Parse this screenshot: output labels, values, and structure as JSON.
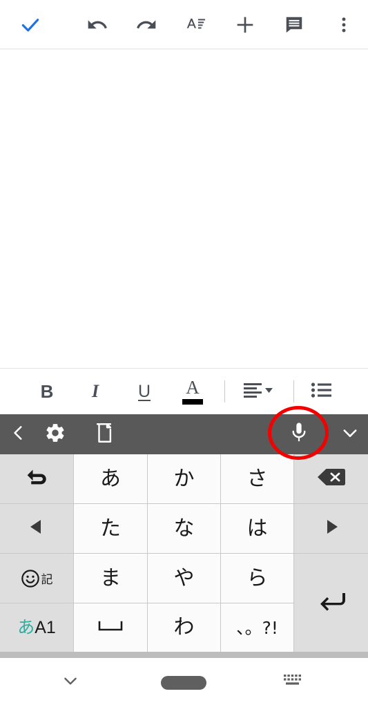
{
  "app": {
    "name": "Document editor",
    "accent_blue": "#1a73e8",
    "toolbar_icon_color": "#4a4f57",
    "ime_bar_color": "#595959",
    "key_kana_bg": "#fbfbfb",
    "key_func_bg": "#dedede",
    "mode_kana_color": "#2bb0a3",
    "annotation_color": "#f40000"
  },
  "top_toolbar": {
    "buttons": [
      {
        "name": "accept-check-button",
        "icon": "check-icon",
        "label": "Done",
        "color": "#1a73e8"
      },
      {
        "name": "undo-button",
        "icon": "undo-icon",
        "label": "Undo"
      },
      {
        "name": "redo-button",
        "icon": "redo-icon",
        "label": "Redo"
      },
      {
        "name": "format-button",
        "icon": "format-text-icon",
        "label": "Format"
      },
      {
        "name": "insert-button",
        "icon": "plus-icon",
        "label": "Insert"
      },
      {
        "name": "comment-button",
        "icon": "comment-icon",
        "label": "Comment"
      },
      {
        "name": "more-options-button",
        "icon": "overflow-menu-icon",
        "label": "More options"
      }
    ]
  },
  "document": {
    "body_text": "",
    "background": "#ffffff"
  },
  "format_bar": {
    "buttons": [
      {
        "name": "bold-button",
        "label": "B",
        "icon": "bold-icon"
      },
      {
        "name": "italic-button",
        "label": "I",
        "icon": "italic-icon"
      },
      {
        "name": "underline-button",
        "label": "U",
        "icon": "underline-icon"
      },
      {
        "name": "text-color-button",
        "label": "A",
        "icon": "text-color-icon",
        "swatch": "#000000"
      },
      {
        "name": "align-button",
        "label": "",
        "icon": "align-left-dropdown-icon"
      },
      {
        "name": "bulleted-list-button",
        "label": "",
        "icon": "bulleted-list-icon"
      }
    ]
  },
  "ime_toolbar": {
    "buttons": [
      {
        "name": "ime-back-button",
        "icon": "chevron-left-icon",
        "label": "Back"
      },
      {
        "name": "ime-settings-button",
        "icon": "gear-icon",
        "label": "Settings"
      },
      {
        "name": "ime-clipboard-button",
        "icon": "clipboard-history-icon",
        "label": "Clipboard history"
      },
      {
        "name": "ime-voice-input-button",
        "icon": "microphone-icon",
        "label": "Voice input",
        "highlighted": true
      },
      {
        "name": "ime-expand-button",
        "icon": "chevron-down-icon",
        "label": "Collapse toolbar"
      }
    ]
  },
  "keyboard": {
    "layout": "japanese-12-key-flick",
    "rows": [
      [
        {
          "name": "key-undo",
          "label": "↶",
          "type": "func",
          "icon": "undo-arrow-icon"
        },
        {
          "name": "key-a-row",
          "label": "あ",
          "type": "kana"
        },
        {
          "name": "key-ka-row",
          "label": "か",
          "type": "kana"
        },
        {
          "name": "key-sa-row",
          "label": "さ",
          "type": "kana"
        },
        {
          "name": "key-backspace",
          "label": "",
          "type": "func",
          "icon": "backspace-icon"
        }
      ],
      [
        {
          "name": "key-cursor-left",
          "label": "◀",
          "type": "func",
          "icon": "arrow-left-icon"
        },
        {
          "name": "key-ta-row",
          "label": "た",
          "type": "kana"
        },
        {
          "name": "key-na-row",
          "label": "な",
          "type": "kana"
        },
        {
          "name": "key-ha-row",
          "label": "は",
          "type": "kana"
        },
        {
          "name": "key-cursor-right",
          "label": "▶",
          "type": "func",
          "icon": "arrow-right-icon"
        }
      ],
      [
        {
          "name": "key-emoji-symbols",
          "label": "記",
          "type": "func",
          "icon": "emoji-icon"
        },
        {
          "name": "key-ma-row",
          "label": "ま",
          "type": "kana"
        },
        {
          "name": "key-ya-row",
          "label": "や",
          "type": "kana"
        },
        {
          "name": "key-ra-row",
          "label": "ら",
          "type": "kana"
        },
        {
          "name": "key-enter",
          "label": "",
          "type": "func",
          "icon": "enter-icon"
        }
      ],
      [
        {
          "name": "key-input-mode",
          "label_kana": "あ",
          "label_latin": "A1",
          "type": "func"
        },
        {
          "name": "key-space",
          "label": "⌴",
          "type": "kana",
          "icon": "space-icon"
        },
        {
          "name": "key-wa-row",
          "label": "わ",
          "type": "kana"
        },
        {
          "name": "key-punctuation",
          "label": "、。?!",
          "type": "kana"
        }
      ]
    ]
  },
  "nav_bar": {
    "buttons": [
      {
        "name": "nav-hide-keyboard-button",
        "icon": "chevron-down-icon",
        "label": "Hide keyboard"
      },
      {
        "name": "nav-home-button",
        "icon": "home-pill-icon",
        "label": "Home"
      },
      {
        "name": "nav-switch-keyboard-button",
        "icon": "keyboard-icon",
        "label": "Change keyboard"
      }
    ]
  },
  "annotation": {
    "name": "highlight-circle",
    "target": "ime-voice-input-button",
    "shape": "ellipse",
    "color": "#f40000"
  }
}
